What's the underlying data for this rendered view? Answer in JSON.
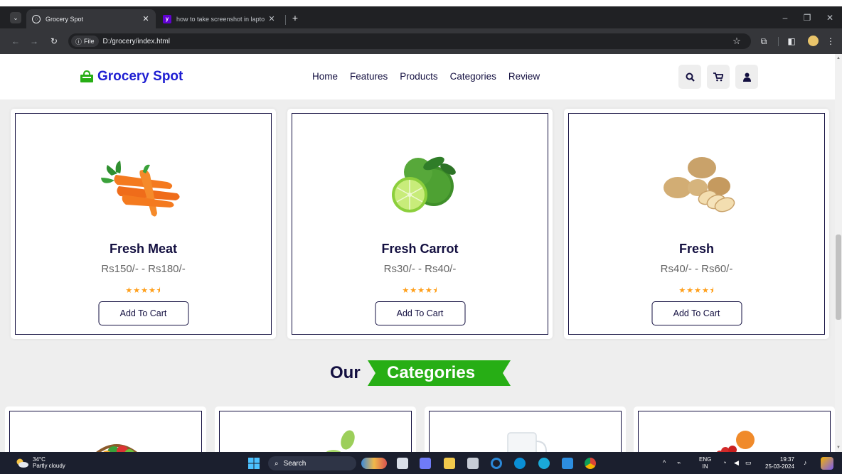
{
  "browser": {
    "tabs": [
      {
        "title": "Grocery Spot",
        "active": true,
        "favicon": "globe-icon"
      },
      {
        "title": "how to take screenshot in lapto",
        "active": false,
        "favicon": "yahoo-icon"
      }
    ],
    "url_chip": "File",
    "url": "D:/grocery/index.html"
  },
  "site": {
    "logo_text": "Grocery Spot",
    "nav": [
      "Home",
      "Features",
      "Products",
      "Categories",
      "Review"
    ],
    "header_icons": [
      "search-icon",
      "cart-icon",
      "user-icon"
    ]
  },
  "products": [
    {
      "name": "Fresh Meat",
      "price": "Rs150/- - Rs180/-",
      "rating": 4.5,
      "image": "carrot-image",
      "button": "Add To Cart"
    },
    {
      "name": "Fresh Carrot",
      "price": "Rs30/- - Rs40/-",
      "rating": 4.5,
      "image": "lime-image",
      "button": "Add To Cart"
    },
    {
      "name": "Fresh",
      "price": "Rs40/- - Rs60/-",
      "rating": 4.5,
      "image": "potato-image",
      "button": "Add To Cart"
    }
  ],
  "stars_display": "★★★★⯨",
  "section": {
    "heading_our": "Our",
    "heading_highlight": "Categories"
  },
  "colors": {
    "brand": "#1e1ed2",
    "heading": "#130f40",
    "accent_green": "#27ae15",
    "star": "#ff9f1a"
  },
  "taskbar": {
    "weather_temp": "34°C",
    "weather_desc": "Partly cloudy",
    "search_label": "Search",
    "lang_line1": "ENG",
    "lang_line2": "IN",
    "time": "19:37",
    "date": "25-03-2024"
  }
}
